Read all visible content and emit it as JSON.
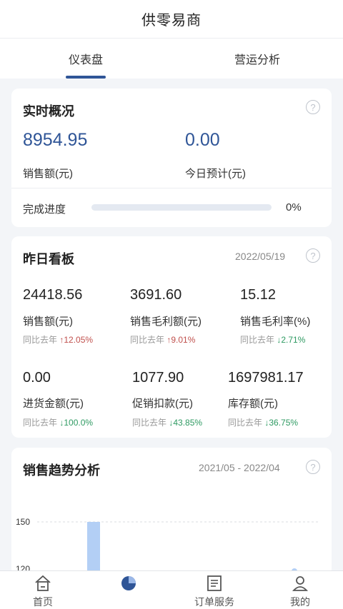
{
  "app": {
    "title": "供零易商"
  },
  "tabs": [
    {
      "label": "仪表盘",
      "active": true
    },
    {
      "label": "营运分析",
      "active": false
    }
  ],
  "realtime": {
    "title": "实时概况",
    "sales_value": "8954.95",
    "sales_label": "销售额(元)",
    "forecast_value": "0.00",
    "forecast_label": "今日预计(元)",
    "progress_label": "完成进度",
    "progress_text": "0%",
    "progress_fraction": 0
  },
  "yesterday": {
    "title": "昨日看板",
    "date": "2022/05/19",
    "metrics": [
      {
        "value": "24418.56",
        "label": "销售额(元)",
        "cmp_prefix": "同比去年",
        "cmp_text": "↑12.05%",
        "dir": "up"
      },
      {
        "value": "3691.60",
        "label": "销售毛利额(元)",
        "cmp_prefix": "同比去年",
        "cmp_text": "↑9.01%",
        "dir": "up"
      },
      {
        "value": "15.12",
        "label": "销售毛利率(%)",
        "cmp_prefix": "同比去年",
        "cmp_text": "↓2.71%",
        "dir": "down"
      },
      {
        "value": "0.00",
        "label": "进货金额(元)",
        "cmp_prefix": "同比去年",
        "cmp_text": "↓100.0%",
        "dir": "down"
      },
      {
        "value": "1077.90",
        "label": "促销扣款(元)",
        "cmp_prefix": "同比去年",
        "cmp_text": "↓43.85%",
        "dir": "down"
      },
      {
        "value": "1697981.17",
        "label": "库存额(元)",
        "cmp_prefix": "同比去年",
        "cmp_text": "↓36.75%",
        "dir": "down"
      }
    ]
  },
  "trend": {
    "title": "销售趋势分析",
    "range": "2021/05 - 2022/04"
  },
  "chart_data": {
    "type": "bar",
    "y_ticks": [
      150,
      120
    ],
    "bar_color": "#b3cff5"
  },
  "nav": [
    {
      "label": "首页",
      "icon": "home-icon"
    },
    {
      "label": "",
      "icon": "pie-chart-icon"
    },
    {
      "label": "订单服务",
      "icon": "order-list-icon"
    },
    {
      "label": "我的",
      "icon": "user-icon"
    }
  ],
  "colors": {
    "accent": "#2f5597",
    "up": "#c0504d",
    "down": "#2e9a62"
  }
}
